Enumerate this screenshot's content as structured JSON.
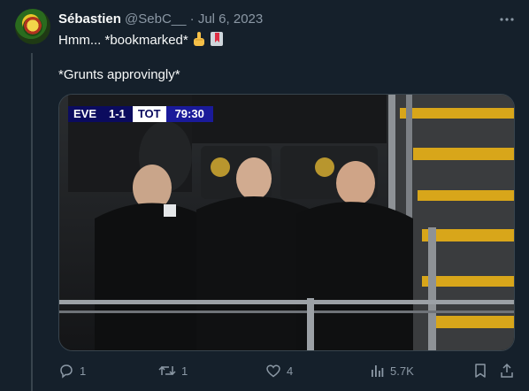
{
  "tweet": {
    "author_name": "Sébastien",
    "author_handle": "@SebC__",
    "separator": "·",
    "date": "Jul 6, 2023",
    "line1": "Hmm... *bookmarked*",
    "line1_emojis": [
      "pointing-up-hand-emoji",
      "bookmark-emoji"
    ],
    "line2": "*Grunts approvingly*"
  },
  "media": {
    "scoreboard": {
      "home": "EVE",
      "score": "1-1",
      "away": "TOT",
      "clock": "79:30"
    }
  },
  "actions": {
    "replies": "1",
    "retweets": "1",
    "likes": "4",
    "views": "5.7K"
  },
  "colors": {
    "background": "#15202b",
    "text": "#f7f9f9",
    "muted": "#8b98a5",
    "border": "#38444d"
  }
}
